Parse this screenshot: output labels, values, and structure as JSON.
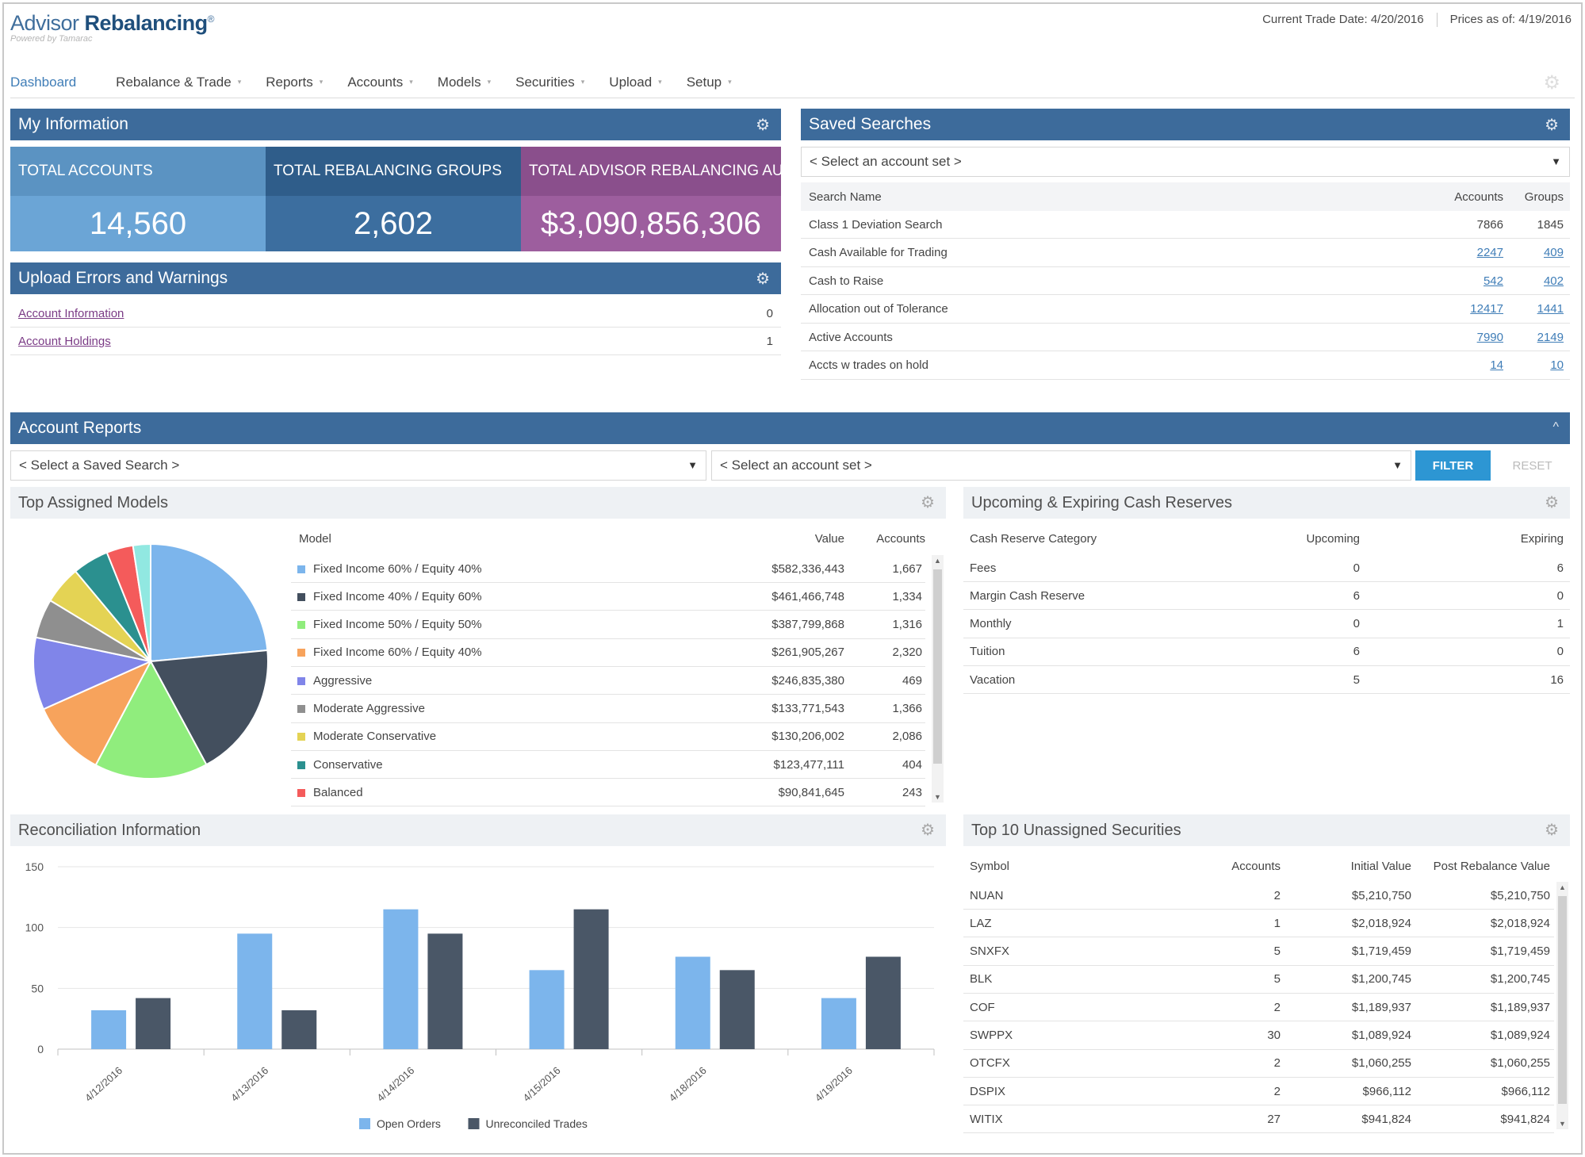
{
  "app": {
    "title_regular": "Advisor ",
    "title_bold": "Rebalancing",
    "trademark": "®",
    "subtitle": "Powered by Tamarac"
  },
  "header": {
    "trade_date": "Current Trade Date: 4/20/2016",
    "prices_as_of": "Prices as of: 4/19/2016"
  },
  "nav": {
    "items": [
      {
        "label": "Dashboard",
        "active": true
      },
      {
        "label": "Rebalance & Trade"
      },
      {
        "label": "Reports"
      },
      {
        "label": "Accounts"
      },
      {
        "label": "Models"
      },
      {
        "label": "Securities"
      },
      {
        "label": "Upload"
      },
      {
        "label": "Setup"
      }
    ],
    "caret": "▾",
    "gear": "⚙"
  },
  "my_information": {
    "title": "My Information",
    "tiles": [
      {
        "label": "TOTAL ACCOUNTS",
        "value": "14,560",
        "head_color": "#5b93c2",
        "val_color": "#6ba5d6"
      },
      {
        "label": "TOTAL REBALANCING GROUPS",
        "value": "2,602",
        "head_color": "#2f5d8a",
        "val_color": "#3c6e9f"
      },
      {
        "label": "TOTAL ADVISOR REBALANCING AUM",
        "value": "$3,090,856,306",
        "head_color": "#8a4f8c",
        "val_color": "#9d5e9e"
      }
    ]
  },
  "upload_errors": {
    "title": "Upload Errors and Warnings",
    "rows": [
      {
        "label": "Account Information",
        "count": "0"
      },
      {
        "label": "Account Holdings",
        "count": "1"
      }
    ]
  },
  "saved_searches": {
    "title": "Saved Searches",
    "select_placeholder": "< Select an account set >",
    "columns": {
      "name": "Search Name",
      "accounts": "Accounts",
      "groups": "Groups"
    },
    "rows": [
      {
        "name": "Class 1 Deviation Search",
        "accounts": "7866",
        "groups": "1845",
        "linked": false
      },
      {
        "name": "Cash Available for Trading",
        "accounts": "2247",
        "groups": "409",
        "linked": true
      },
      {
        "name": "Cash to Raise",
        "accounts": "542",
        "groups": "402",
        "linked": true
      },
      {
        "name": "Allocation out of Tolerance",
        "accounts": "12417",
        "groups": "1441",
        "linked": true
      },
      {
        "name": "Active Accounts",
        "accounts": "7990",
        "groups": "2149",
        "linked": true
      },
      {
        "name": "Accts w trades on hold",
        "accounts": "14",
        "groups": "10",
        "linked": true
      }
    ]
  },
  "account_reports": {
    "title": "Account Reports",
    "collapse_icon": "^",
    "saved_search_placeholder": "< Select a Saved Search >",
    "account_set_placeholder": "< Select an account set >",
    "filter_label": "FILTER",
    "reset_label": "RESET"
  },
  "top_models": {
    "title": "Top Assigned Models",
    "columns": {
      "model": "Model",
      "value": "Value",
      "accounts": "Accounts"
    },
    "rows": [
      {
        "name": "Fixed Income 60% / Equity 40%",
        "value": "$582,336,443",
        "accounts": "1,667",
        "color": "#7cb5ec"
      },
      {
        "name": "Fixed Income 40% / Equity 60%",
        "value": "$461,466,748",
        "accounts": "1,334",
        "color": "#434f5e"
      },
      {
        "name": "Fixed Income 50% / Equity 50%",
        "value": "$387,799,868",
        "accounts": "1,316",
        "color": "#90ed7d"
      },
      {
        "name": "Fixed Income 60% / Equity 40%",
        "value": "$261,905,267",
        "accounts": "2,320",
        "color": "#f7a35c"
      },
      {
        "name": "Aggressive",
        "value": "$246,835,380",
        "accounts": "469",
        "color": "#8085e9"
      },
      {
        "name": "Moderate Aggressive",
        "value": "$133,771,543",
        "accounts": "1,366",
        "color": "#8f8f8f"
      },
      {
        "name": "Moderate Conservative",
        "value": "$130,206,002",
        "accounts": "2,086",
        "color": "#e4d354"
      },
      {
        "name": "Conservative",
        "value": "$123,477,111",
        "accounts": "404",
        "color": "#2b908f"
      },
      {
        "name": "Balanced",
        "value": "$90,841,645",
        "accounts": "243",
        "color": "#f45b5b"
      }
    ],
    "extra_slice": {
      "value": 60,
      "color": "#91e8e1"
    }
  },
  "cash_reserves": {
    "title": "Upcoming & Expiring Cash Reserves",
    "columns": {
      "category": "Cash Reserve Category",
      "upcoming": "Upcoming",
      "expiring": "Expiring"
    },
    "rows": [
      {
        "category": "Fees",
        "upcoming": "0",
        "expiring": "6"
      },
      {
        "category": "Margin Cash Reserve",
        "upcoming": "6",
        "expiring": "0"
      },
      {
        "category": "Monthly",
        "upcoming": "0",
        "expiring": "1"
      },
      {
        "category": "Tuition",
        "upcoming": "6",
        "expiring": "0"
      },
      {
        "category": "Vacation",
        "upcoming": "5",
        "expiring": "16"
      }
    ]
  },
  "chart_data": {
    "type": "bar",
    "title": "Reconciliation Information",
    "categories": [
      "4/12/2016",
      "4/13/2016",
      "4/14/2016",
      "4/15/2016",
      "4/18/2016",
      "4/19/2016"
    ],
    "series": [
      {
        "name": "Open Orders",
        "values": [
          32,
          95,
          115,
          65,
          76,
          42
        ],
        "color": "#7cb5ec"
      },
      {
        "name": "Unreconciled Trades",
        "values": [
          42,
          32,
          95,
          115,
          65,
          76
        ],
        "color": "#4a5767"
      }
    ],
    "ylim": [
      0,
      150
    ],
    "yticks": [
      0,
      50,
      100,
      150
    ],
    "grid": true,
    "legend": "bottom"
  },
  "unassigned_securities": {
    "title": "Top 10 Unassigned Securities",
    "columns": {
      "symbol": "Symbol",
      "accounts": "Accounts",
      "initial": "Initial Value",
      "post": "Post Rebalance Value"
    },
    "rows": [
      {
        "symbol": "NUAN",
        "accounts": "2",
        "initial": "$5,210,750",
        "post": "$5,210,750"
      },
      {
        "symbol": "LAZ",
        "accounts": "1",
        "initial": "$2,018,924",
        "post": "$2,018,924"
      },
      {
        "symbol": "SNXFX",
        "accounts": "5",
        "initial": "$1,719,459",
        "post": "$1,719,459"
      },
      {
        "symbol": "BLK",
        "accounts": "5",
        "initial": "$1,200,745",
        "post": "$1,200,745"
      },
      {
        "symbol": "COF",
        "accounts": "2",
        "initial": "$1,189,937",
        "post": "$1,189,937"
      },
      {
        "symbol": "SWPPX",
        "accounts": "30",
        "initial": "$1,089,924",
        "post": "$1,089,924"
      },
      {
        "symbol": "OTCFX",
        "accounts": "2",
        "initial": "$1,060,255",
        "post": "$1,060,255"
      },
      {
        "symbol": "DSPIX",
        "accounts": "2",
        "initial": "$966,112",
        "post": "$966,112"
      },
      {
        "symbol": "WITIX",
        "accounts": "27",
        "initial": "$941,824",
        "post": "$941,824"
      }
    ]
  },
  "icons": {
    "gear": "⚙",
    "dropdown": "▼",
    "scroll_up": "▲",
    "scroll_down": "▼"
  }
}
